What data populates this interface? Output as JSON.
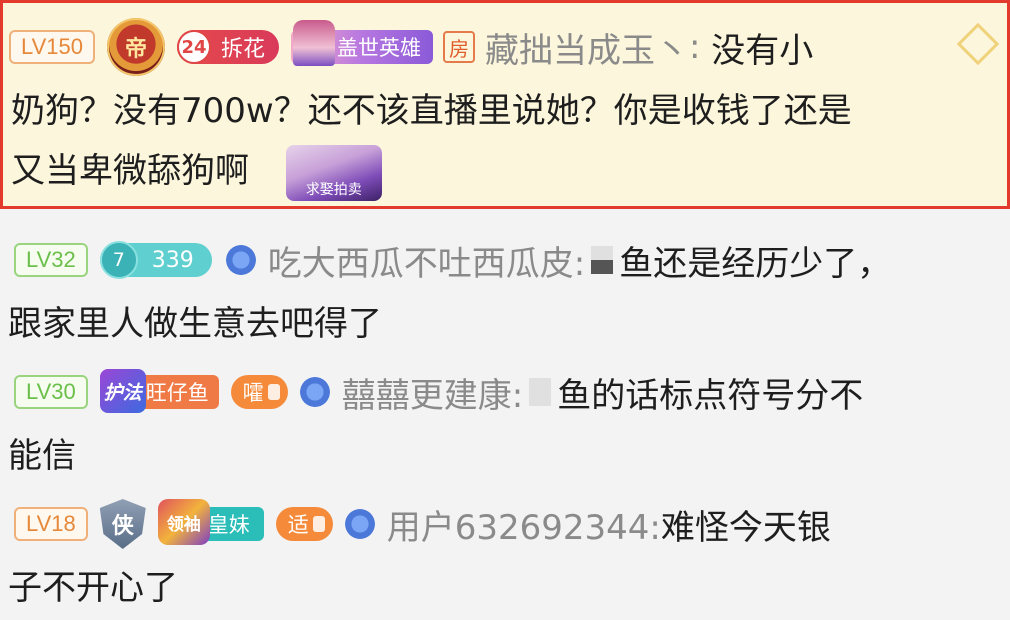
{
  "messages": [
    {
      "level": "LV150",
      "emperor_glyph": "帝",
      "fan_badge": {
        "level": "24",
        "name": "拆花"
      },
      "hero_badge": "盖世英雄",
      "room_tag": "房",
      "username": "藏拙当成玉丶",
      "text_first": "没有小",
      "text_lines": [
        "奶狗？没有700w？还不该直播里说她？你是收钱了还是",
        "又当卑微舔狗啊"
      ],
      "sticker_text": "求娶拍卖"
    },
    {
      "level": "LV32",
      "badge": {
        "level": "7",
        "name": "339"
      },
      "username": "吃大西瓜不吐西瓜皮:",
      "text_first": "鱼还是经历少了，",
      "text_lines": [
        "跟家里人做生意去吧得了"
      ]
    },
    {
      "level": "LV30",
      "guard_badge": {
        "logo": "护法",
        "name": "旺仔鱼"
      },
      "orange_tag": "嚯",
      "username": "囍囍更建康:",
      "text_first": "鱼的话标点符号分不",
      "text_lines": [
        "能信"
      ]
    },
    {
      "level": "LV18",
      "shield_glyph": "侠",
      "teal_badge": {
        "logo": "领袖",
        "name": "皇妹"
      },
      "orange_tag": "适",
      "username": "用户632692344:",
      "text_first": "难怪今天银",
      "text_lines": [
        "子不开心了"
      ]
    }
  ]
}
